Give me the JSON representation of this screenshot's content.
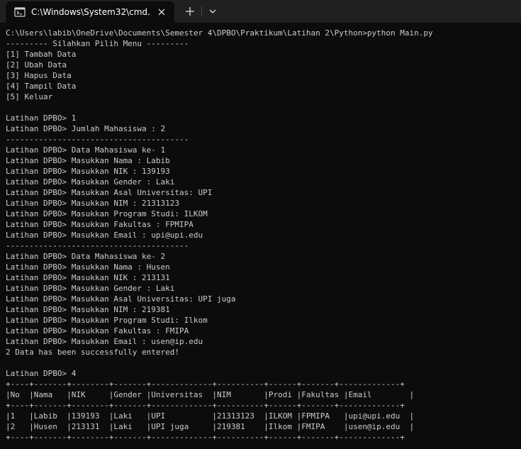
{
  "window": {
    "tab_title": "C:\\Windows\\System32\\cmd.e",
    "tab_icon": "terminal-icon",
    "close_icon": "close-icon",
    "new_tab_icon": "plus-icon",
    "dropdown_icon": "chevron-down-icon",
    "colors": {
      "background": "#0c0c0c",
      "titlebar": "#202020",
      "text": "#cccccc"
    }
  },
  "console": {
    "lines": [
      "C:\\Users\\labib\\OneDrive\\Documents\\Semester 4\\DPBO\\Praktikum\\Latihan 2\\Python>python Main.py",
      "--------- Silahkan Pilih Menu ---------",
      "[1] Tambah Data",
      "[2] Ubah Data",
      "[3] Hapus Data",
      "[4] Tampil Data",
      "[5] Keluar",
      "",
      "Latihan DPBO> 1",
      "Latihan DPBO> Jumlah Mahasiswa : 2",
      "---------------------------------------",
      "Latihan DPBO> Data Mahasiswa ke- 1",
      "Latihan DPBO> Masukkan Nama : Labib",
      "Latihan DPBO> Masukkan NIK : 139193",
      "Latihan DPBO> Masukkan Gender : Laki",
      "Latihan DPBO> Masukkan Asal Universitas: UPI",
      "Latihan DPBO> Masukkan NIM : 21313123",
      "Latihan DPBO> Masukkan Program Studi: ILKOM",
      "Latihan DPBO> Masukkan Fakultas : FPMIPA",
      "Latihan DPBO> Masukkan Email : upi@upi.edu",
      "---------------------------------------",
      "Latihan DPBO> Data Mahasiswa ke- 2",
      "Latihan DPBO> Masukkan Nama : Husen",
      "Latihan DPBO> Masukkan NIK : 213131",
      "Latihan DPBO> Masukkan Gender : Laki",
      "Latihan DPBO> Masukkan Asal Universitas: UPI juga",
      "Latihan DPBO> Masukkan NIM : 219381",
      "Latihan DPBO> Masukkan Program Studi: Ilkom",
      "Latihan DPBO> Masukkan Fakultas : FMIPA",
      "Latihan DPBO> Masukkan Email : usen@ip.edu",
      "2 Data has been successfully entered!",
      "",
      "Latihan DPBO> 4",
      "+----+-------+--------+-------+-------------+----------+------+-------+-------------+",
      "|No  |Nama   |NIK     |Gender |Universitas  |NIM       |Prodi |Fakultas |Email        |",
      "+----+-------+--------+-------+-------------+----------+------+-------+-------------+",
      "|1   |Labib  |139193  |Laki   |UPI          |21313123  |ILKOM |FPMIPA   |upi@upi.edu  |",
      "|2   |Husen  |213131  |Laki   |UPI juga     |219381    |Ilkom |FMIPA    |usen@ip.edu  |",
      "+----+-------+--------+-------+-------------+----------+------+-------+-------------+"
    ]
  }
}
